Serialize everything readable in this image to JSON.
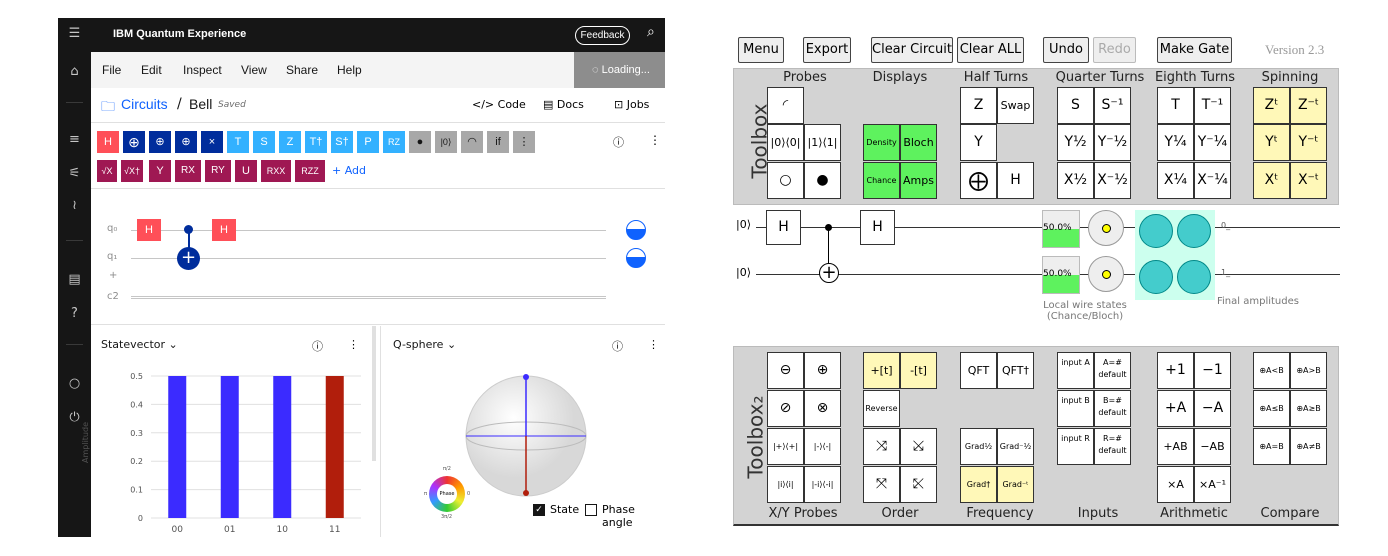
{
  "ibm": {
    "app_title": "IBM Quantum Experience",
    "feedback_label": "Feedback",
    "menu": [
      "File",
      "Edit",
      "Inspect",
      "View",
      "Share",
      "Help"
    ],
    "loading_label": "Loading...",
    "breadcrumb": {
      "root": "Circuits",
      "sep": "/",
      "name": "Bell",
      "status": "Saved"
    },
    "actions": {
      "code": "Code",
      "docs": "Docs",
      "jobs": "Jobs"
    },
    "gates_row1": [
      "H",
      "⊕",
      "",
      "",
      "",
      "T",
      "S",
      "Z",
      "T†",
      "S†",
      "P",
      "RZ",
      "●",
      "|0⟩",
      "",
      "if",
      "⋮"
    ],
    "gates_row2": [
      "√X",
      "√X†",
      "Y",
      "RX",
      "RY",
      "U",
      "RXX",
      "RZZ"
    ],
    "add_label": "+ Add",
    "qubits": [
      "q₀",
      "q₁",
      "+",
      "c2"
    ],
    "circuit_gates": {
      "h1": "H",
      "h2": "H"
    },
    "statevector": {
      "title": "Statevector",
      "ylabel": "Amplitude",
      "ticks": [
        "0.5",
        "0.4",
        "0.3",
        "0.2",
        "0.1",
        "0"
      ]
    },
    "qsphere": {
      "title": "Q-sphere",
      "phase_label": "Phase",
      "phase_pi2": "π/2",
      "phase_pi": "π",
      "phase_0": "0",
      "phase_3pi2": "3π/2",
      "state_label": "State",
      "phase_angle_label": "Phase angle"
    },
    "colors": {
      "bar_blue": "#3b2bff",
      "bar_red": "#b11e0c",
      "accent": "#0f62fe"
    }
  },
  "chart_data": {
    "type": "bar",
    "categories": [
      "00",
      "01",
      "10",
      "11"
    ],
    "values": [
      0.5,
      0.5,
      0.5,
      0.5
    ],
    "ylabel": "Amplitude",
    "ylim": [
      0,
      0.5
    ]
  },
  "quirk": {
    "buttons": {
      "menu": "Menu",
      "export": "Export",
      "clear_circuit": "Clear Circuit",
      "clear_all": "Clear ALL",
      "undo": "Undo",
      "redo": "Redo",
      "make_gate": "Make Gate"
    },
    "version": "Version 2.3",
    "toolbox1_label": "Toolbox",
    "toolbox2_label": "Toolbox₂",
    "cats1": [
      "Probes",
      "Displays",
      "Half Turns",
      "Quarter Turns",
      "Eighth Turns",
      "Spinning"
    ],
    "cats2": [
      "X/Y Probes",
      "Order",
      "Frequency",
      "Inputs",
      "Arithmetic",
      "Compare"
    ],
    "probes": [
      "",
      "|0⟩⟨0|",
      "|1⟩⟨1|",
      "○",
      "●"
    ],
    "displays": [
      "Density",
      "Bloch",
      "Chance",
      "Amps"
    ],
    "half": [
      "Z",
      "Swap",
      "Y",
      "⨁",
      "H"
    ],
    "quarter": [
      "S",
      "S⁻¹",
      "Y½",
      "Y⁻½",
      "X½",
      "X⁻½"
    ],
    "eighth": [
      "T",
      "T⁻¹",
      "Y¼",
      "Y⁻¼",
      "X¼",
      "X⁻¼"
    ],
    "spin": [
      "Zᵗ",
      "Z⁻ᵗ",
      "Yᵗ",
      "Y⁻ᵗ",
      "Xᵗ",
      "X⁻ᵗ"
    ],
    "xyprobes": [
      "⊖",
      "⊕",
      "⊘",
      "⊗",
      "|+⟩⟨+|",
      "|-⟩⟨-|",
      "|i⟩⟨i|",
      "|-i⟩⟨-i|"
    ],
    "order": [
      "+[t]",
      "-[t]",
      "Reverse"
    ],
    "freq": [
      "QFT",
      "QFT†",
      "Grad½",
      "Grad⁻½",
      "Grad†",
      "Grad⁻ᵗ"
    ],
    "inputs": [
      "input A",
      "A=#",
      "default",
      "input B",
      "B=#",
      "default",
      "input R",
      "R=#",
      "default"
    ],
    "arith": [
      "+1",
      "−1",
      "+A",
      "−A",
      "+AB",
      "−AB",
      "×A",
      "×A⁻¹"
    ],
    "compare": [
      "⊕A<B",
      "⊕A>B",
      "⊕A≤B",
      "⊕A≥B",
      "⊕A=B",
      "⊕A≠B"
    ],
    "wires": [
      "|0⟩",
      "|0⟩"
    ],
    "circuit": {
      "h1": "H",
      "h2": "H"
    },
    "percent": [
      "50.0%",
      "50.0%"
    ],
    "local_states": "Local wire states (Chance/Bloch)",
    "final_amps": "Final amplitudes",
    "amp_labels": [
      "0_",
      "1_"
    ]
  }
}
